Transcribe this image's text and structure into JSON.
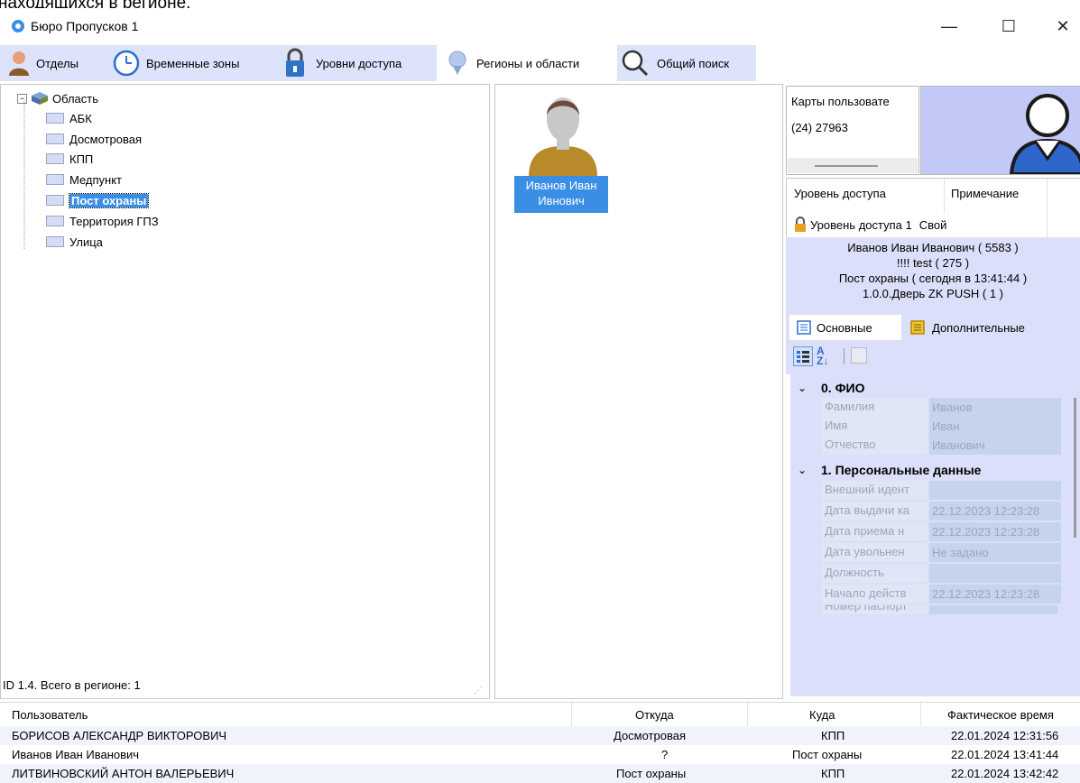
{
  "page_fragment": "находящихся в регионе.",
  "window": {
    "title": "Бюро Пропусков 1",
    "minimize": "—",
    "maximize": "☐",
    "close": "✕"
  },
  "tabs": [
    {
      "label": "Отделы"
    },
    {
      "label": "Временные зоны"
    },
    {
      "label": "Уровни доступа"
    },
    {
      "label": "Регионы и области"
    },
    {
      "label": "Общий поиск"
    }
  ],
  "tree": {
    "root": "Область",
    "items": [
      "АБК",
      "Досмотровая",
      "КПП",
      "Медпункт",
      "Пост охраны",
      "Территория ГПЗ",
      "Улица"
    ],
    "selected": "Пост охраны"
  },
  "status": {
    "text": "ID 1.4. Всего в регионе: 1"
  },
  "user_tile": {
    "line1": "Иванов Иван",
    "line2": "Ивнович"
  },
  "cards": {
    "header": "Карты пользовате",
    "value": "(24) 27963"
  },
  "access": {
    "col_level": "Уровень доступа",
    "col_note": "Примечание",
    "level": "Уровень доступа 1",
    "note": "Свой"
  },
  "info": {
    "line1": "Иванов Иван Иванович ( 5583 )",
    "line2": "!!!! test ( 275 )",
    "line3": "Пост охраны ( сегодня в 13:41:44 )",
    "line4": "1.0.0.Дверь ZK PUSH ( 1 )"
  },
  "subtabs": {
    "main": "Основные",
    "extra": "Дополнительные"
  },
  "props": {
    "cat0": "0. ФИО",
    "cat1": "1. Персональные данные",
    "fio": [
      {
        "k": "Фамилия",
        "v": "Иванов"
      },
      {
        "k": "Имя",
        "v": "Иван"
      },
      {
        "k": "Отчество",
        "v": "Иванович"
      }
    ],
    "personal": [
      {
        "k": "Внешний идент",
        "v": ""
      },
      {
        "k": "Дата выдачи ка",
        "v": "22.12.2023 12:23:28"
      },
      {
        "k": "Дата приема н",
        "v": "22.12.2023 12:23:28"
      },
      {
        "k": "Дата увольнен",
        "v": "Не задано"
      },
      {
        "k": "Должность",
        "v": ""
      },
      {
        "k": "Начало действ",
        "v": "22.12.2023 12:23:28"
      },
      {
        "k": "Номер паспорт",
        "v": ""
      }
    ]
  },
  "log": {
    "headers": {
      "user": "Пользователь",
      "from": "Откуда",
      "to": "Куда",
      "time": "Фактическое время"
    },
    "rows": [
      {
        "user": "БОРИСОВ АЛЕКСАНДР ВИКТОРОВИЧ",
        "from": "Досмотровая",
        "to": "КПП",
        "time": "22.01.2024 12:31:56"
      },
      {
        "user": "Иванов Иван Иванович",
        "from": "?",
        "to": "Пост охраны",
        "time": "22.01.2024 13:41:44"
      },
      {
        "user": "ЛИТВИНОВСКИЙ АНТОН ВАЛЕРЬЕВИЧ",
        "from": "Пост охраны",
        "to": "КПП",
        "time": "22.01.2024 13:42:42"
      }
    ]
  },
  "colors": {
    "accent": "#3b8ee5",
    "panel": "#dcdff9",
    "tabstrip": "#dde3fb"
  }
}
